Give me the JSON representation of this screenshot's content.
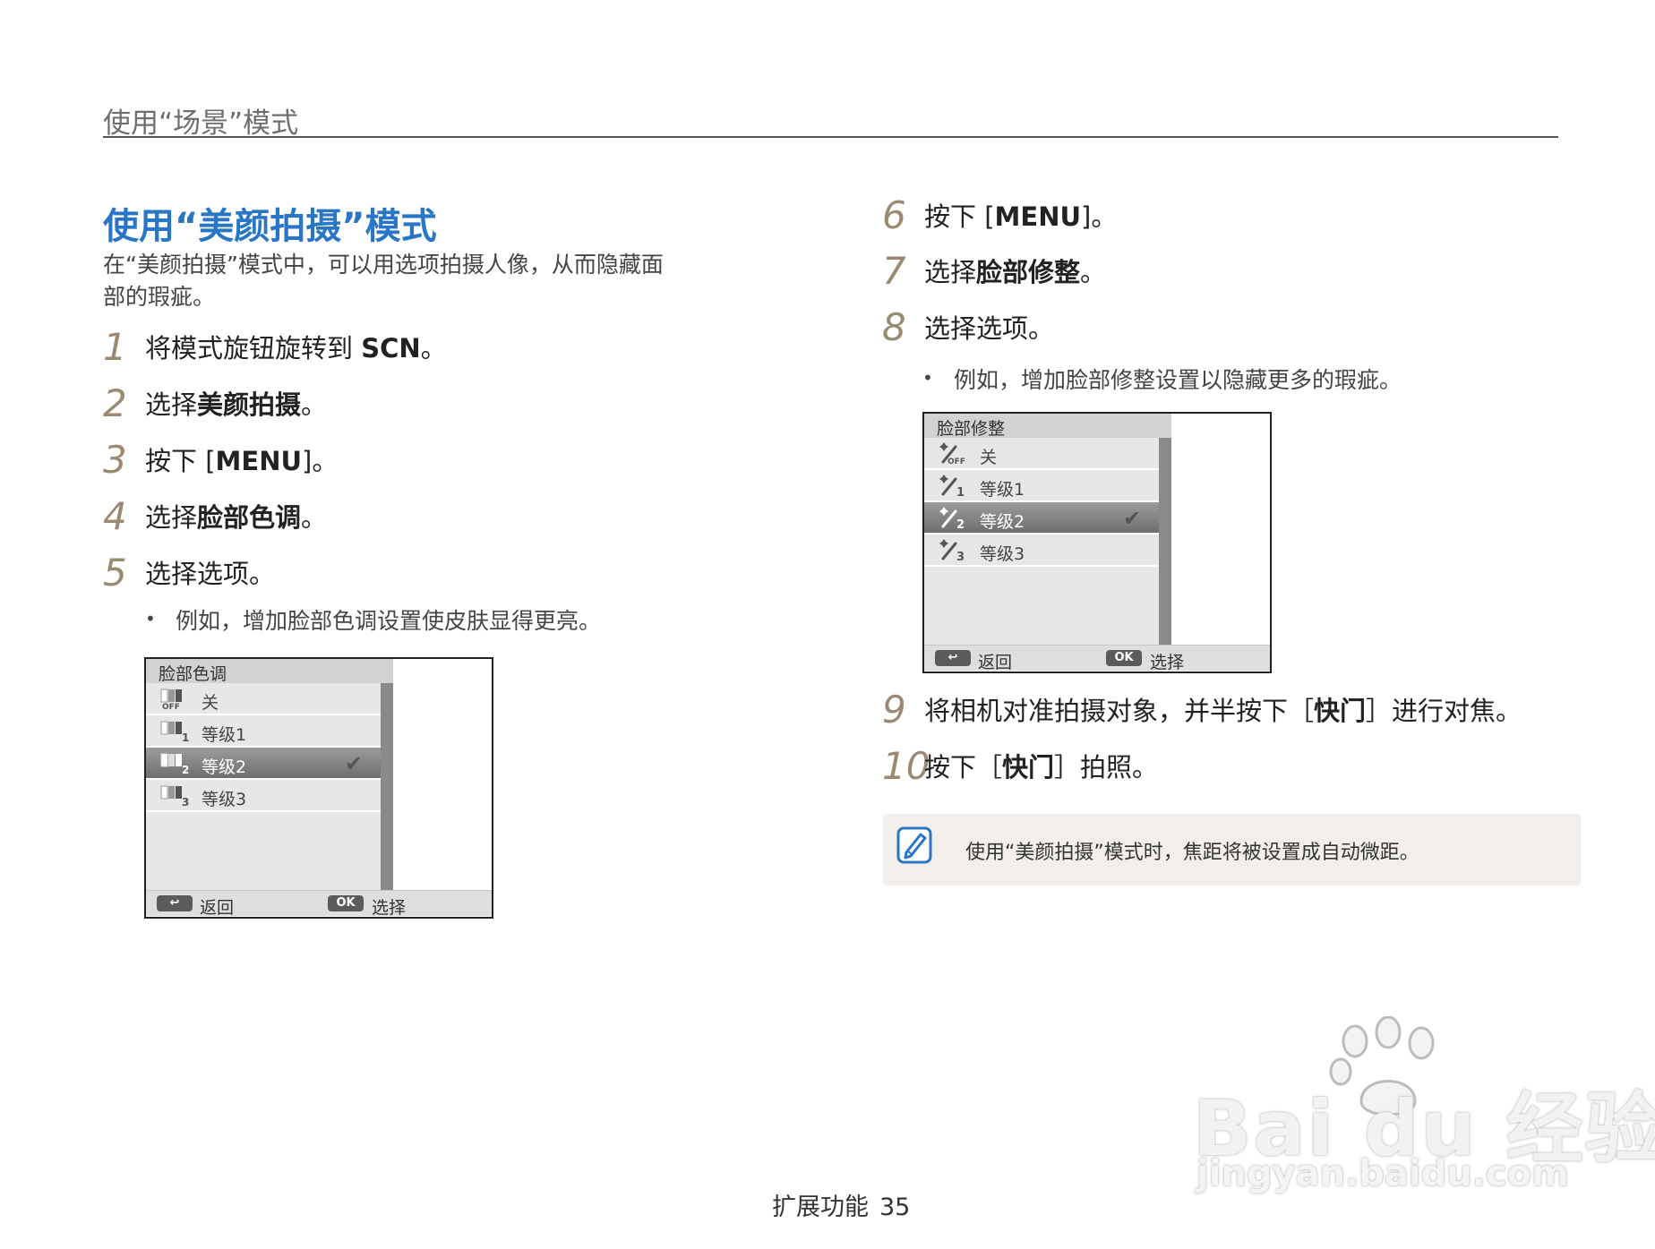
{
  "header": {
    "title": "使用“场景”模式"
  },
  "section": {
    "title": "使用“美颜拍摄”模式",
    "intro_line1": "在“美颜拍摄”模式中，可以用选项拍摄人像，从而隐藏面",
    "intro_line2": "部的瑕疵。"
  },
  "steps_left": [
    {
      "num": "1",
      "pre": "将模式旋钮旋转到 ",
      "bold": "SCN",
      "post": "。"
    },
    {
      "num": "2",
      "pre": "选择",
      "bold": "美颜拍摄",
      "post": "。"
    },
    {
      "num": "3",
      "pre": "按下 [",
      "bold": "MENU",
      "post": "]。"
    },
    {
      "num": "4",
      "pre": "选择",
      "bold": "脸部色调",
      "post": "。"
    },
    {
      "num": "5",
      "pre": "选择选项。",
      "bold": "",
      "post": ""
    }
  ],
  "bullet_left": "例如，增加脸部色调设置使皮肤显得更亮。",
  "steps_right": [
    {
      "num": "6",
      "pre": "按下 [",
      "bold": "MENU",
      "post": "]。"
    },
    {
      "num": "7",
      "pre": "选择",
      "bold": "脸部修整",
      "post": "。"
    },
    {
      "num": "8",
      "pre": "选择选项。",
      "bold": "",
      "post": ""
    }
  ],
  "bullet_right": "例如，增加脸部修整设置以隐藏更多的瑕疵。",
  "steps_right_after": [
    {
      "num": "9",
      "pre": "将相机对准拍摄对象，并半按下［",
      "bold": "快门",
      "post": "］进行对焦。"
    },
    {
      "num": "10",
      "pre": "按下［",
      "bold": "快门",
      "post": "］拍照。"
    }
  ],
  "screen_tone": {
    "title": "脸部色调",
    "items": [
      {
        "label": "关",
        "icon": "tone-off-icon",
        "icon_text": "OFF"
      },
      {
        "label": "等级1",
        "icon": "tone-level1-icon",
        "icon_text": "1"
      },
      {
        "label": "等级2",
        "icon": "tone-level2-icon",
        "icon_text": "2"
      },
      {
        "label": "等级3",
        "icon": "tone-level3-icon",
        "icon_text": "3"
      }
    ],
    "selected_index": 2,
    "back_key": "↩",
    "back_label": "返回",
    "ok_key": "OK",
    "ok_label": "选择"
  },
  "screen_retouch": {
    "title": "脸部修整",
    "items": [
      {
        "label": "关",
        "icon": "retouch-off-icon",
        "icon_text": "OFF"
      },
      {
        "label": "等级1",
        "icon": "retouch-level1-icon",
        "icon_text": "1"
      },
      {
        "label": "等级2",
        "icon": "retouch-level2-icon",
        "icon_text": "2"
      },
      {
        "label": "等级3",
        "icon": "retouch-level3-icon",
        "icon_text": "3"
      }
    ],
    "selected_index": 2,
    "back_key": "↩",
    "back_label": "返回",
    "ok_key": "OK",
    "ok_label": "选择"
  },
  "note": {
    "icon": "note-pencil-icon",
    "text": "使用“美颜拍摄”模式时，焦距将被设置成自动微距。"
  },
  "footer": {
    "section": "扩展功能",
    "page": "35"
  },
  "watermark": {
    "brand": "Bai du 经验",
    "url": "jingyan.baidu.com"
  },
  "colors": {
    "title_blue": "#2a76c6",
    "step_number": "#9a8a72",
    "note_bg": "#f2eeea",
    "note_icon": "#2a76c6"
  }
}
